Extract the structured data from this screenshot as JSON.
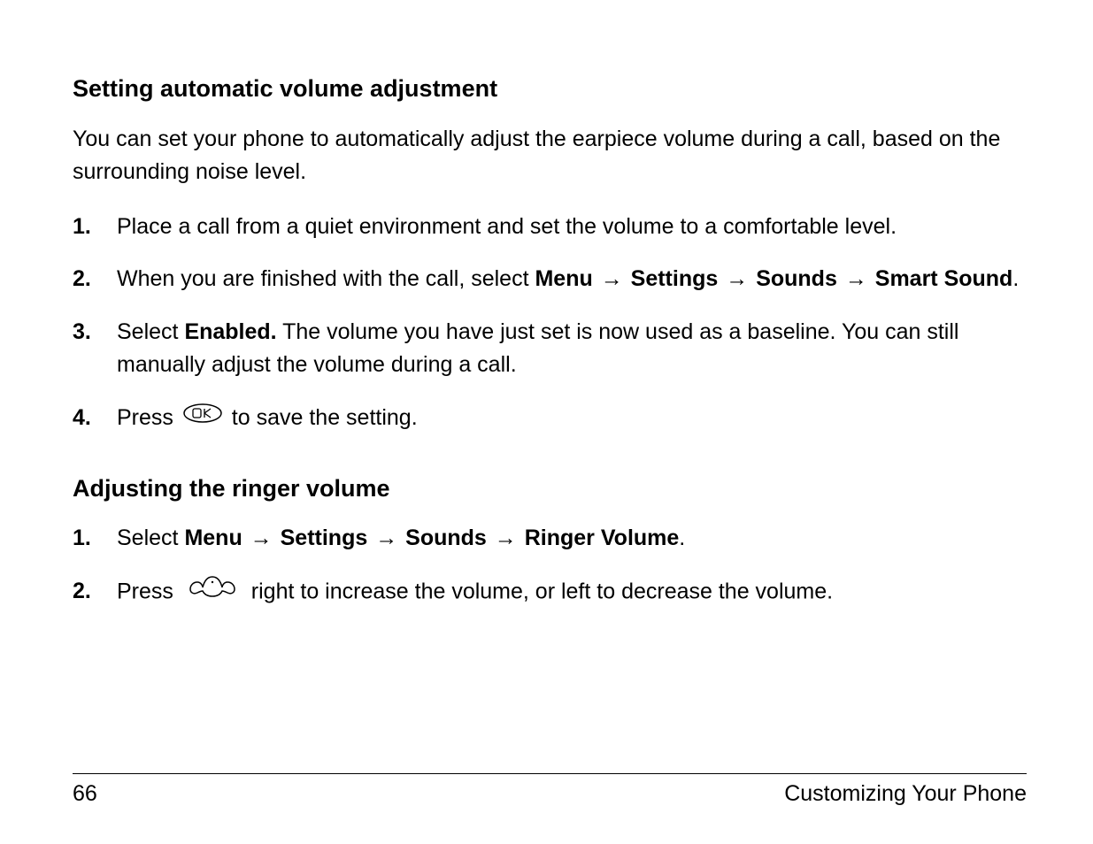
{
  "section1": {
    "heading": "Setting automatic volume adjustment",
    "intro": "You can set your phone to automatically adjust the earpiece volume during a call, based on the surrounding noise level.",
    "steps": {
      "s1_num": "1.",
      "s1_text": "Place a call from a quiet environment and set the volume to a comfortable level.",
      "s2_num": "2.",
      "s2_pre": "When you are finished with the call, select ",
      "s2_menu": "Menu",
      "s2_settings": "Settings",
      "s2_sounds": "Sounds",
      "s2_smart": "Smart Sound",
      "s2_period": ".",
      "s3_num": "3.",
      "s3_pre": "Select ",
      "s3_enabled": "Enabled.",
      "s3_post": " The volume you have just set is now used as a baseline. You can still manually adjust the volume during a call.",
      "s4_num": "4.",
      "s4_pre": "Press ",
      "s4_post": " to save the setting."
    }
  },
  "section2": {
    "heading": "Adjusting the ringer volume",
    "steps": {
      "s1_num": "1.",
      "s1_pre": "Select ",
      "s1_menu": "Menu",
      "s1_settings": "Settings",
      "s1_sounds": "Sounds",
      "s1_ringer": "Ringer Volume",
      "s1_period": ".",
      "s2_num": "2.",
      "s2_pre": "Press ",
      "s2_post": " right to increase the volume, or left to decrease the volume."
    }
  },
  "arrow": "→",
  "footer": {
    "pagenum": "66",
    "chapter": "Customizing Your Phone"
  }
}
